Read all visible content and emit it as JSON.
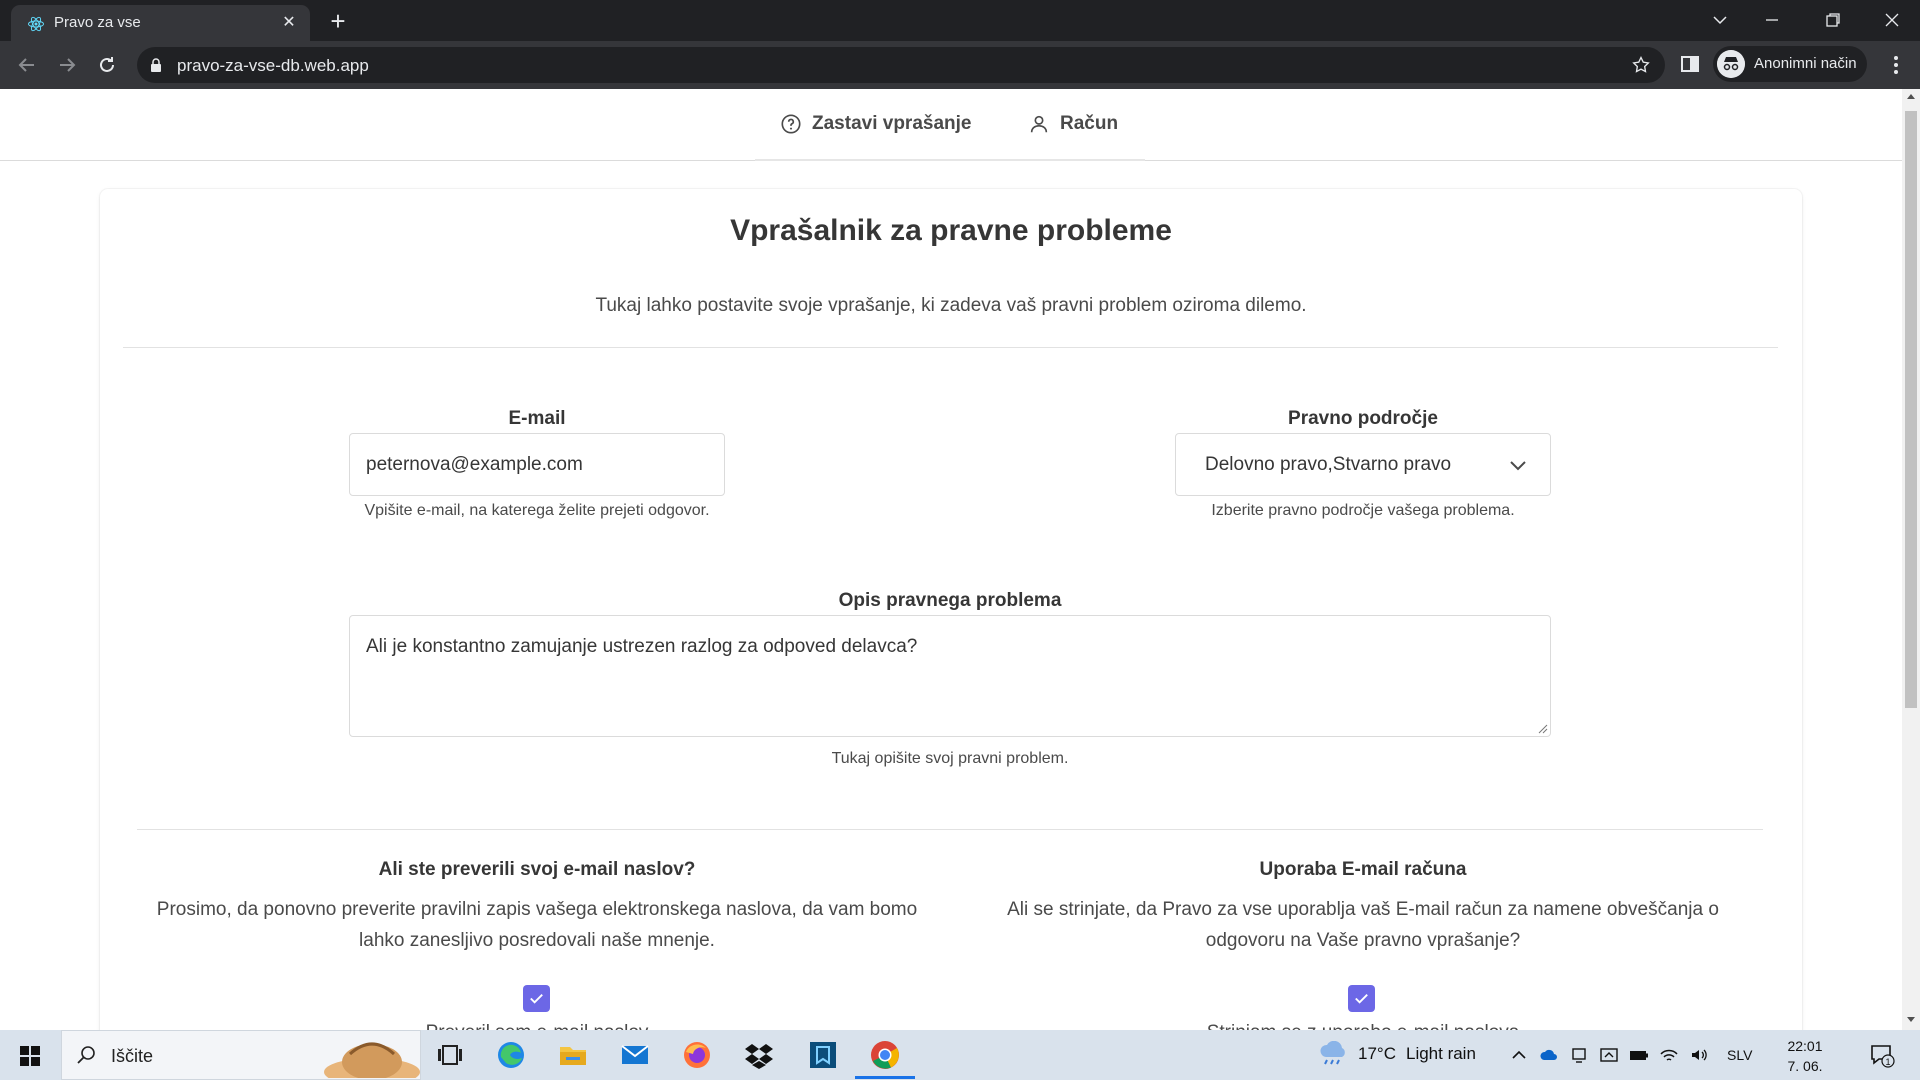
{
  "browser": {
    "tab_title": "Pravo za vse",
    "url": "pravo-za-vse-db.web.app",
    "incognito_label": "Anonimni način"
  },
  "nav": {
    "ask_label": "Zastavi vprašanje",
    "account_label": "Račun"
  },
  "form": {
    "title": "Vprašalnik za pravne probleme",
    "subtitle": "Tukaj lahko postavite svoje vprašanje, ki zadeva vaš pravni problem oziroma dilemo.",
    "email": {
      "label": "E-mail",
      "value": "peternova@example.com",
      "help": "Vpišite e-mail, na katerega želite prejeti odgovor."
    },
    "area": {
      "label": "Pravno področje",
      "value": "Delovno pravo,Stvarno pravo",
      "help": "Izberite pravno področje vašega problema."
    },
    "description": {
      "label": "Opis pravnega problema",
      "value": "Ali je konstantno zamujanje ustrezen razlog za odpoved delavca?",
      "help": "Tukaj opišite svoj pravni problem."
    },
    "verify": {
      "title": "Ali ste preverili svoj e-mail naslov?",
      "line1": "Prosimo, da ponovno preverite pravilni zapis vašega elektronskega naslova, da vam bomo",
      "line2": "lahko zanesljivo posredovali naše mnenje.",
      "checkbox_label": "Preveril sem e-mail naslov",
      "checked": true
    },
    "consent": {
      "title": "Uporaba E-mail računa",
      "line1": "Ali se strinjate, da Pravo za vse uporablja vaš E-mail račun za namene obveščanja o",
      "line2": "odgovoru na Vaše pravno vprašanje?",
      "checkbox_label": "Strinjam se z uporabo e-mail naslova",
      "checked": true
    }
  },
  "taskbar": {
    "search_placeholder": "Iščite",
    "weather_temp": "17°C",
    "weather_desc": "Light rain",
    "language": "SLV",
    "time": "22:01",
    "date": "7. 06. 2023",
    "notification_count": "1"
  },
  "colors": {
    "checkbox": "#6c67e6",
    "tabbar": "#202124",
    "toolbar": "#35363a",
    "taskbar": "#d9e2ec"
  }
}
